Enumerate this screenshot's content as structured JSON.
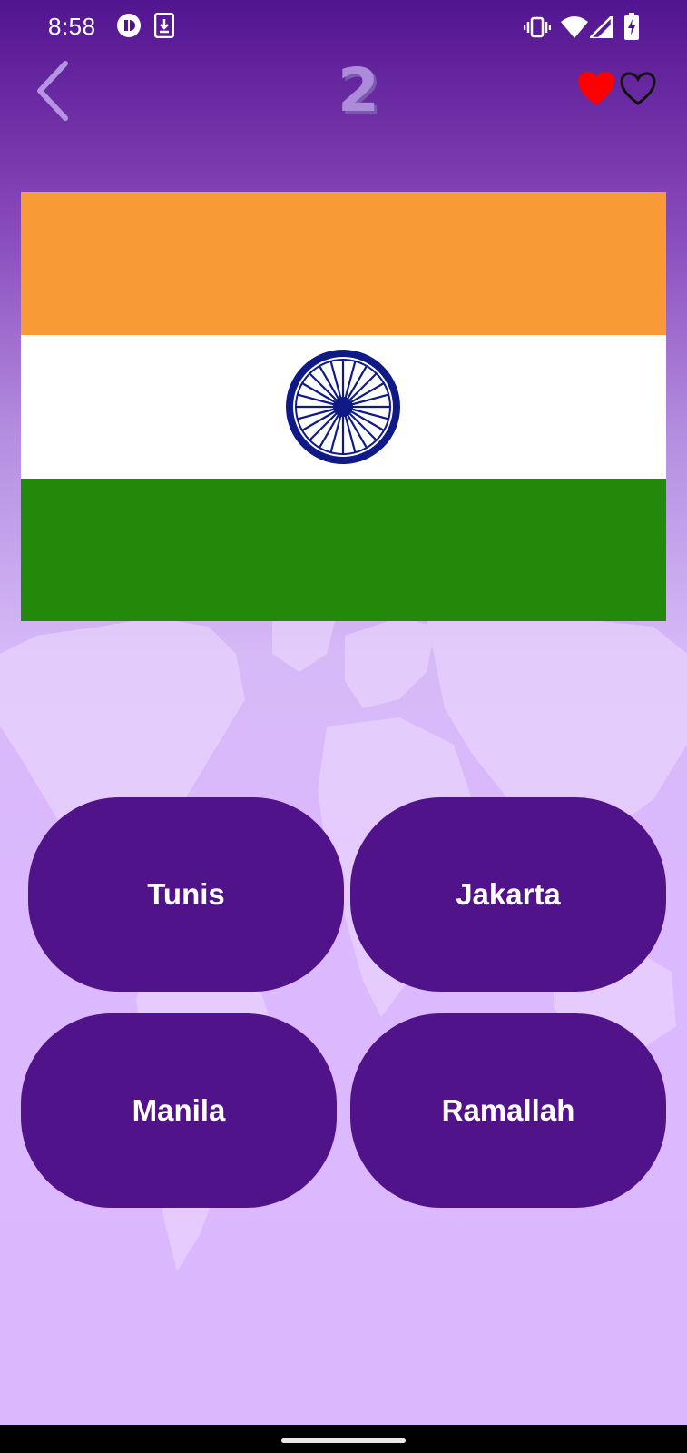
{
  "status_bar": {
    "time": "8:58",
    "icons": [
      "app-notification-icon",
      "download-icon",
      "vibrate-icon",
      "wifi-icon",
      "signal-icon",
      "battery-charging-icon"
    ]
  },
  "header": {
    "back_icon": "chevron-left-icon",
    "level": "2",
    "lives": {
      "remaining": 1,
      "total": 2,
      "icons": [
        "heart-filled-icon",
        "heart-outline-icon"
      ]
    }
  },
  "flag": {
    "country": "India",
    "colors": {
      "saffron": "#f89a36",
      "white": "#ffffff",
      "green": "#23890b",
      "chakra": "#0f1a86"
    }
  },
  "answers": [
    {
      "label": "Tunis"
    },
    {
      "label": "Jakarta"
    },
    {
      "label": "Manila"
    },
    {
      "label": "Ramallah"
    }
  ],
  "colors": {
    "answer_button": "#51138a",
    "accent": "#521590",
    "heart_filled": "#ff0000"
  }
}
